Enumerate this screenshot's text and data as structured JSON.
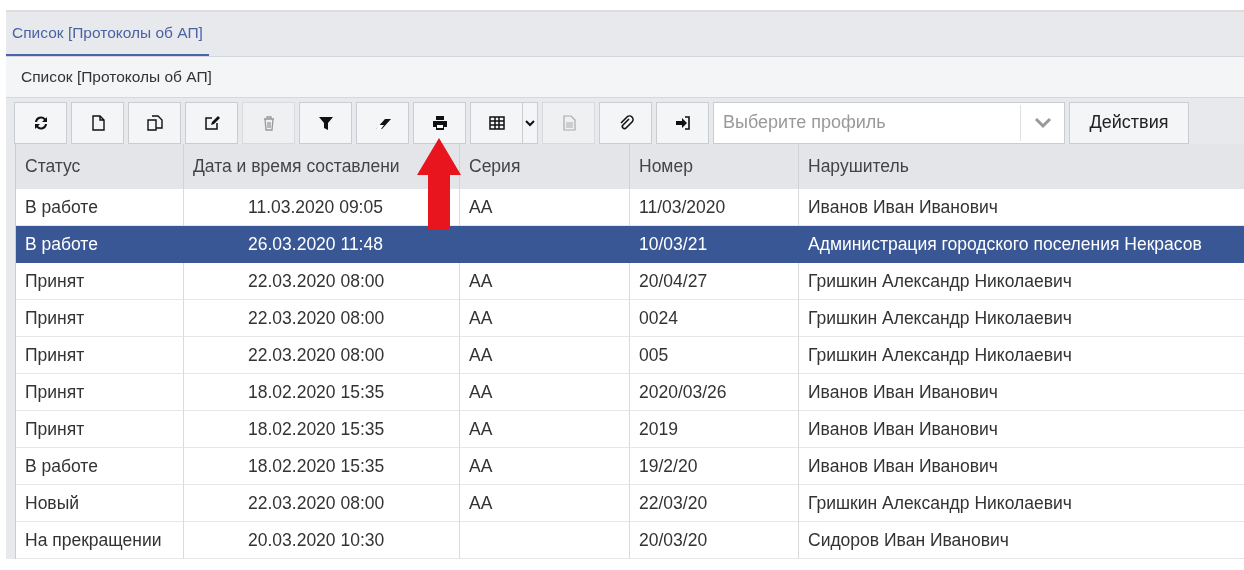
{
  "tabs": [
    {
      "label": "Список [Протоколы об АП]",
      "selected": true
    }
  ],
  "panel": {
    "title": "Список [Протоколы об АП]"
  },
  "toolbar": [
    {
      "kind": "refresh",
      "disabled": false
    },
    {
      "kind": "new",
      "disabled": false
    },
    {
      "kind": "copy",
      "disabled": false
    },
    {
      "kind": "edit",
      "disabled": false
    },
    {
      "kind": "delete",
      "disabled": true
    },
    {
      "kind": "filter",
      "disabled": false
    },
    {
      "kind": "clear",
      "disabled": false
    },
    {
      "kind": "print",
      "disabled": false
    },
    {
      "kind": "columns",
      "disabled": false
    },
    {
      "kind": "document",
      "disabled": true
    },
    {
      "kind": "attach",
      "disabled": false
    },
    {
      "kind": "login",
      "disabled": false
    }
  ],
  "profile": {
    "placeholder": "Выберите профиль"
  },
  "actions_button": "Действия",
  "annotation": {
    "kind": "arrow"
  },
  "table": {
    "columns": [
      "Статус",
      "Дата и время составлени",
      "Серия",
      "Номер",
      "Нарушитель"
    ],
    "rows": [
      {
        "selected": false,
        "cells": [
          "В работе",
          "11.03.2020 09:05",
          "АА",
          "11/03/2020",
          "Иванов Иван Иванович"
        ]
      },
      {
        "selected": true,
        "cells": [
          "В работе",
          "26.03.2020 11:48",
          null,
          "10/03/21",
          "Администрация городского поселения Некрасов"
        ]
      },
      {
        "selected": false,
        "cells": [
          "Принят",
          "22.03.2020 08:00",
          "АА",
          "20/04/27",
          "Гришкин Александр Николаевич"
        ]
      },
      {
        "selected": false,
        "cells": [
          "Принят",
          "22.03.2020 08:00",
          "АА",
          "0024",
          "Гришкин Александр Николаевич"
        ]
      },
      {
        "selected": false,
        "cells": [
          "Принят",
          "22.03.2020 08:00",
          "АА",
          "005",
          "Гришкин Александр Николаевич"
        ]
      },
      {
        "selected": false,
        "cells": [
          "Принят",
          "18.02.2020 15:35",
          "АА",
          "2020/03/26",
          "Иванов Иван Иванович"
        ]
      },
      {
        "selected": false,
        "cells": [
          "Принят",
          "18.02.2020 15:35",
          "АА",
          "2019",
          "Иванов Иван Иванович"
        ]
      },
      {
        "selected": false,
        "cells": [
          "В работе",
          "18.02.2020 15:35",
          "АА",
          "19/2/20",
          "Иванов Иван Иванович"
        ]
      },
      {
        "selected": false,
        "cells": [
          "Новый",
          "22.03.2020 08:00",
          "АА",
          "22/03/20",
          "Гришкин Александр Николаевич"
        ]
      },
      {
        "selected": false,
        "cells": [
          "На прекращении",
          "20.03.2020 10:30",
          null,
          "20/03/20",
          "Сидоров Иван Иванович"
        ]
      }
    ]
  }
}
